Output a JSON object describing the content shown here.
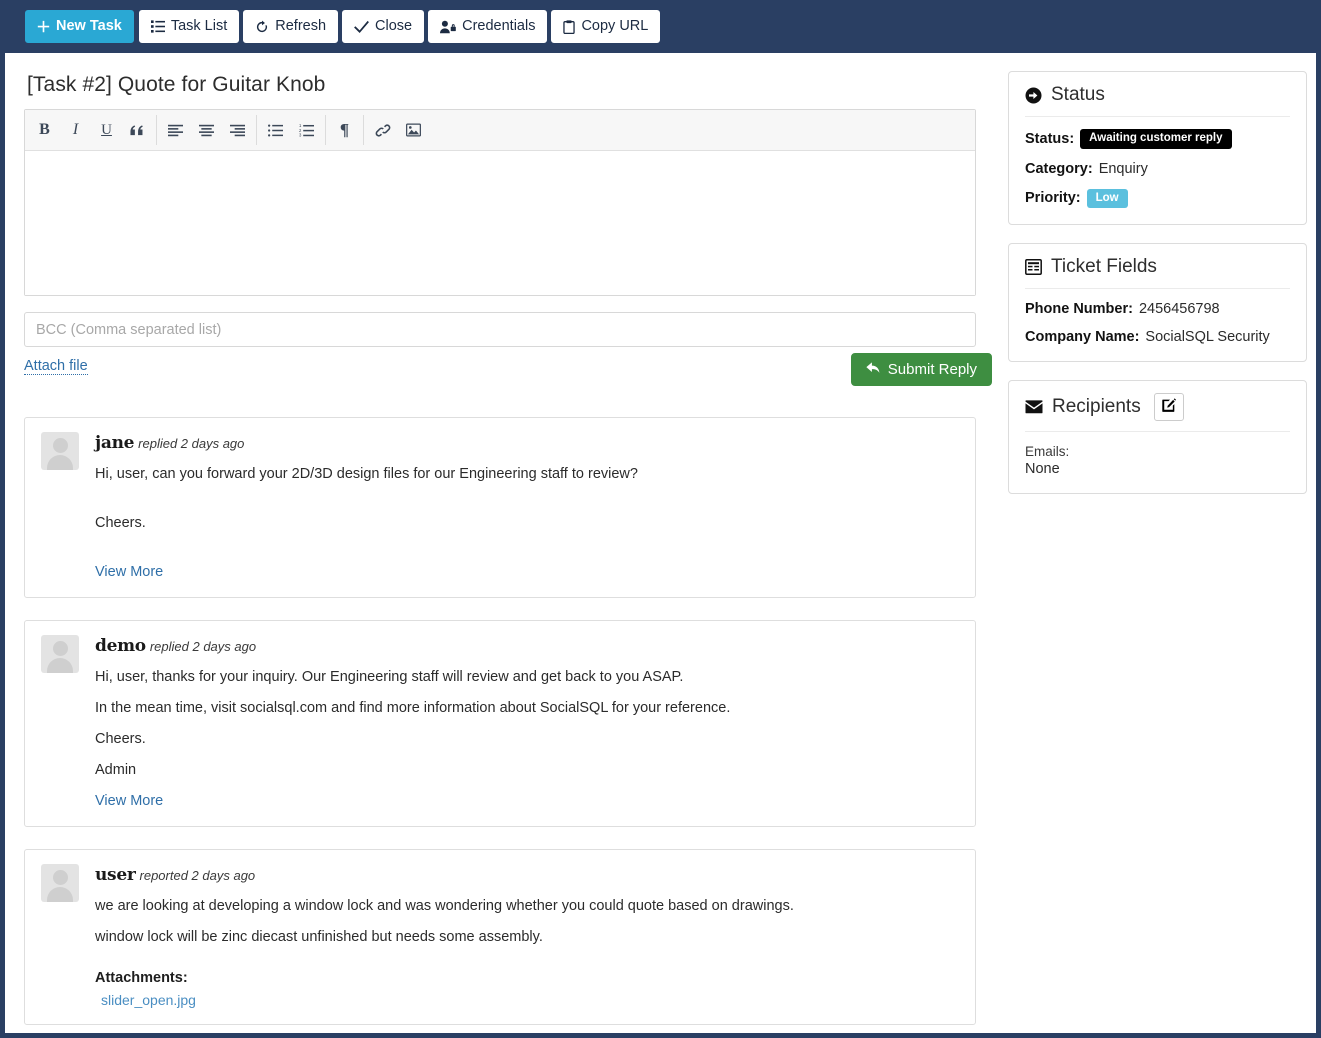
{
  "navbar": {
    "buttons": [
      {
        "label": "New Task",
        "icon": "plus-icon",
        "primary": true
      },
      {
        "label": "Task List",
        "icon": "list-icon",
        "primary": false
      },
      {
        "label": "Refresh",
        "icon": "refresh-icon",
        "primary": false
      },
      {
        "label": "Close",
        "icon": "check-icon",
        "primary": false
      },
      {
        "label": "Credentials",
        "icon": "user-lock-icon",
        "primary": false
      },
      {
        "label": "Copy URL",
        "icon": "clipboard-icon",
        "primary": false
      }
    ]
  },
  "main": {
    "title": "[Task #2] Quote for Guitar Knob",
    "editor": {
      "toolbar": [
        {
          "name": "bold-icon",
          "glyph": "B"
        },
        {
          "name": "italic-icon",
          "glyph": "I"
        },
        {
          "name": "underline-icon",
          "glyph": "U"
        },
        {
          "name": "blockquote-icon",
          "glyph": "“"
        },
        {
          "name": "align-left-icon",
          "glyph": ""
        },
        {
          "name": "align-center-icon",
          "glyph": ""
        },
        {
          "name": "align-right-icon",
          "glyph": ""
        },
        {
          "name": "unordered-list-icon",
          "glyph": ""
        },
        {
          "name": "ordered-list-icon",
          "glyph": ""
        },
        {
          "name": "rtl-paragraph-icon",
          "glyph": "¶"
        },
        {
          "name": "link-icon",
          "glyph": ""
        },
        {
          "name": "image-icon",
          "glyph": ""
        }
      ],
      "content": ""
    },
    "bcc": {
      "value": "",
      "placeholder": "BCC (Comma separated list)"
    },
    "attach_file_label": "Attach file",
    "submit_label": "Submit Reply",
    "comments": [
      {
        "author": "jane",
        "action": "replied 2 days ago",
        "paragraphs": [
          "Hi, user, can you forward your 2D/3D design files for our Engineering staff to review?",
          "Cheers."
        ],
        "view_more_label": "View More",
        "spaced": true,
        "attachments_label": "",
        "attachments": []
      },
      {
        "author": "demo",
        "action": "replied 2 days ago",
        "paragraphs": [
          "Hi, user, thanks for your inquiry. Our Engineering staff will review and get back to you ASAP.",
          "In the mean time,  visit socialsql.com and find more information about SocialSQL for your reference.",
          "Cheers.",
          "Admin"
        ],
        "view_more_label": "View More",
        "spaced": false,
        "attachments_label": "",
        "attachments": []
      },
      {
        "author": "user",
        "action": "reported 2 days ago",
        "paragraphs": [
          "we are looking at developing a window lock and was wondering whether you could quote based on drawings.",
          "window lock will be zinc diecast unfinished but needs some assembly."
        ],
        "view_more_label": "",
        "spaced": false,
        "attachments_label": "Attachments:",
        "attachments": [
          "slider_open.jpg"
        ]
      }
    ]
  },
  "sidebar": {
    "status_panel": {
      "title": "Status",
      "icon": "arrow-circle-right-icon",
      "status_key": "Status:",
      "status_value": "Awaiting customer reply",
      "status_badge_color": "#000000",
      "category_key": "Category:",
      "category_value": "Enquiry",
      "priority_key": "Priority:",
      "priority_value": "Low",
      "priority_badge_color": "#5bc0de"
    },
    "ticket_fields_panel": {
      "title": "Ticket Fields",
      "icon": "form-icon",
      "fields": [
        {
          "key": "Phone Number:",
          "value": "2456456798"
        },
        {
          "key": "Company Name:",
          "value": "SocialSQL Security"
        }
      ]
    },
    "recipients_panel": {
      "title": "Recipients",
      "icon": "envelope-icon",
      "edit_icon": "edit-pencil-icon",
      "emails_label": "Emails:",
      "emails_value": "None"
    }
  },
  "colors": {
    "navbar": "#2a3f63",
    "primary_button": "#2aa8d4",
    "submit_button": "#3e8e41",
    "link": "#2f6fa8",
    "info_badge": "#5bc0de",
    "dark_badge": "#000000"
  }
}
